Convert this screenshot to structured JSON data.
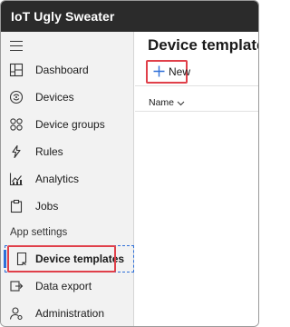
{
  "app": {
    "title": "IoT Ugly Sweater"
  },
  "sidebar": {
    "items": [
      {
        "label": "Dashboard",
        "icon": "dashboard-icon"
      },
      {
        "label": "Devices",
        "icon": "devices-icon"
      },
      {
        "label": "Device groups",
        "icon": "device-groups-icon"
      },
      {
        "label": "Rules",
        "icon": "rules-icon"
      },
      {
        "label": "Analytics",
        "icon": "analytics-icon"
      },
      {
        "label": "Jobs",
        "icon": "jobs-icon"
      }
    ],
    "section": "App settings",
    "settings_items": [
      {
        "label": "Device templates",
        "icon": "device-templates-icon",
        "active": true
      },
      {
        "label": "Data export",
        "icon": "data-export-icon"
      },
      {
        "label": "Administration",
        "icon": "administration-icon"
      }
    ]
  },
  "main": {
    "title": "Device templates",
    "toolbar": {
      "new_label": "New"
    },
    "table": {
      "columns": [
        "Name"
      ]
    }
  },
  "colors": {
    "accent": "#2e6fd8",
    "highlight": "#e0404a",
    "topbar": "#2b2b2b"
  }
}
